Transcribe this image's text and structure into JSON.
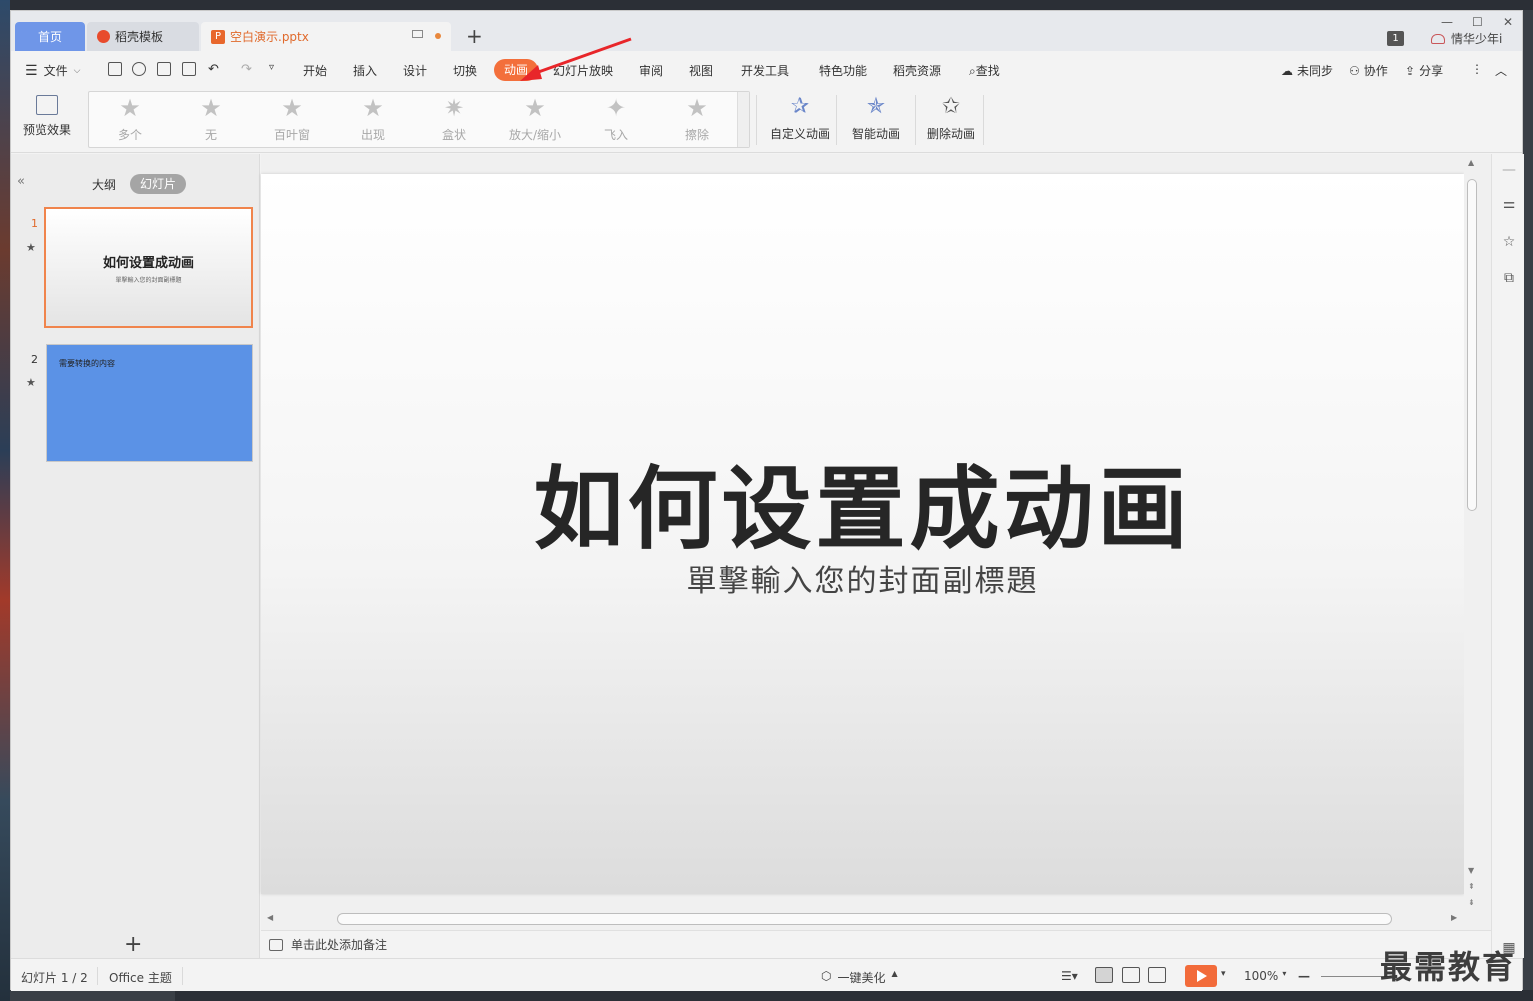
{
  "tabs": {
    "home": "首页",
    "daoke": "稻壳模板",
    "doc": "空白演示.pptx",
    "doc_logo": "P"
  },
  "window": {
    "badge": "1",
    "user_name": "情华少年i"
  },
  "menu": {
    "file": "文件",
    "items": [
      "开始",
      "插入",
      "设计",
      "切换",
      "动画",
      "幻灯片放映",
      "审阅",
      "视图",
      "开发工具",
      "特色功能",
      "稻壳资源",
      "查找"
    ],
    "active": "动画",
    "sync": "未同步",
    "collab": "协作",
    "share": "分享"
  },
  "ribbon": {
    "preview": "预览效果",
    "gallery": [
      "多个",
      "无",
      "百叶窗",
      "出现",
      "盒状",
      "放大/缩小",
      "飞入",
      "擦除"
    ],
    "custom": "自定义动画",
    "smart": "智能动画",
    "delete": "删除动画"
  },
  "leftpanel": {
    "tab_outline": "大纲",
    "tab_slides": "幻灯片",
    "slides": [
      {
        "num": "1",
        "title": "如何设置成动画",
        "subtitle": "單擊輸入您的封面副標題"
      },
      {
        "num": "2",
        "text": "需要转换的内容"
      }
    ]
  },
  "slide": {
    "title": "如何设置成动画",
    "subtitle": "單擊輸入您的封面副標題"
  },
  "notes": {
    "placeholder": "单击此处添加备注"
  },
  "status": {
    "slide_count": "幻灯片 1 / 2",
    "theme": "Office 主题",
    "beautify": "一键美化",
    "zoom": "100%"
  },
  "watermark": "最需教育",
  "colors": {
    "accent": "#f36f3b",
    "home_tab": "#6f96e8",
    "slide2_bg": "#5b92e6"
  }
}
